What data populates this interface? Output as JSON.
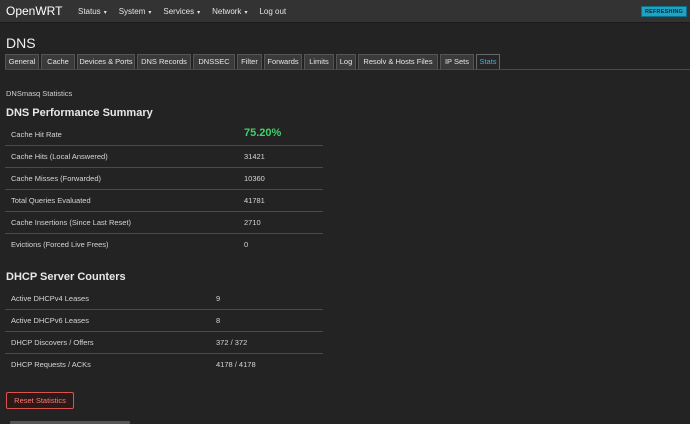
{
  "navbar": {
    "brand": "OpenWRT",
    "menu": [
      {
        "label": "Status",
        "dropdown": true
      },
      {
        "label": "System",
        "dropdown": true
      },
      {
        "label": "Services",
        "dropdown": true
      },
      {
        "label": "Network",
        "dropdown": true
      },
      {
        "label": "Log out",
        "dropdown": false
      }
    ],
    "badge": "REFRESHING"
  },
  "page": {
    "title": "DNS",
    "tabs": [
      {
        "label": "General"
      },
      {
        "label": "Cache"
      },
      {
        "label": "Devices & Ports"
      },
      {
        "label": "DNS Records"
      },
      {
        "label": "DNSSEC"
      },
      {
        "label": "Filter"
      },
      {
        "label": "Forwards"
      },
      {
        "label": "Limits"
      },
      {
        "label": "Log"
      },
      {
        "label": "Resolv & Hosts Files"
      },
      {
        "label": "IP Sets"
      },
      {
        "label": "Stats",
        "active": true
      }
    ],
    "section_label": "DNSmasq Statistics"
  },
  "dns_summary": {
    "heading": "DNS Performance Summary",
    "rows": [
      {
        "label": "Cache Hit Rate",
        "value": "75.20%"
      },
      {
        "label": "Cache Hits (Local Answered)",
        "value": "31421"
      },
      {
        "label": "Cache Misses (Forwarded)",
        "value": "10360"
      },
      {
        "label": "Total Queries Evaluated",
        "value": "41781"
      },
      {
        "label": "Cache Insertions (Since Last Reset)",
        "value": "2710"
      },
      {
        "label": "Evictions (Forced Live Frees)",
        "value": "0"
      }
    ]
  },
  "dhcp_counters": {
    "heading": "DHCP Server Counters",
    "rows": [
      {
        "label": "Active DHCPv4 Leases",
        "value": "9"
      },
      {
        "label": "Active DHCPv6 Leases",
        "value": "8"
      },
      {
        "label": "DHCP Discovers / Offers",
        "value": "372 / 372"
      },
      {
        "label": "DHCP Requests / ACKs",
        "value": "4178 / 4178"
      }
    ]
  },
  "actions": {
    "reset_label": "Reset Statistics"
  },
  "colors": {
    "accent": "#33b5e5",
    "hit_rate": "#3fd169",
    "danger": "#d9534f",
    "badge": "#1ea3c4"
  }
}
